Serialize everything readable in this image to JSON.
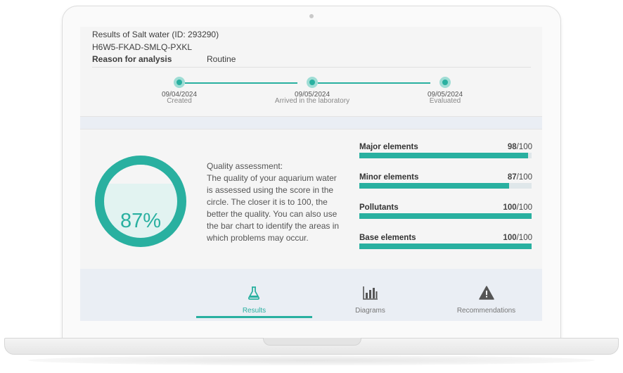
{
  "header": {
    "results_title": "Results of Salt water (ID: 293290)",
    "code": "H6W5-FKAD-SMLQ-PXKL",
    "reason_label": "Reason for analysis",
    "reason_value": "Routine"
  },
  "timeline": [
    {
      "date": "09/04/2024",
      "label": "Created"
    },
    {
      "date": "09/05/2024",
      "label": "Arrived in the laboratory"
    },
    {
      "date": "09/05/2024",
      "label": "Evaluated"
    }
  ],
  "quality": {
    "score_text": "87%",
    "score_value": 87,
    "description_title": "Quality assessment:",
    "description": "The quality of your aquarium water is assessed using the score in the circle. The closer it is to 100, the better the quality. You can also use the bar chart to identify the areas in which problems may occur."
  },
  "bars": [
    {
      "label": "Major elements",
      "score": "98",
      "max": "/100",
      "value": 98
    },
    {
      "label": "Minor elements",
      "score": "87",
      "max": "/100",
      "value": 87
    },
    {
      "label": "Pollutants",
      "score": "100",
      "max": "/100",
      "value": 100
    },
    {
      "label": "Base elements",
      "score": "100",
      "max": "/100",
      "value": 100
    }
  ],
  "tabs": [
    {
      "label": "Results",
      "icon": "flask-icon",
      "active": true
    },
    {
      "label": "Diagrams",
      "icon": "bar-chart-icon",
      "active": false
    },
    {
      "label": "Recommendations",
      "icon": "warning-icon",
      "active": false
    }
  ],
  "colors": {
    "accent": "#29b0a0",
    "accent_light": "#9fddd5",
    "panel": "#f5f5f5",
    "band": "#eaeef4"
  }
}
